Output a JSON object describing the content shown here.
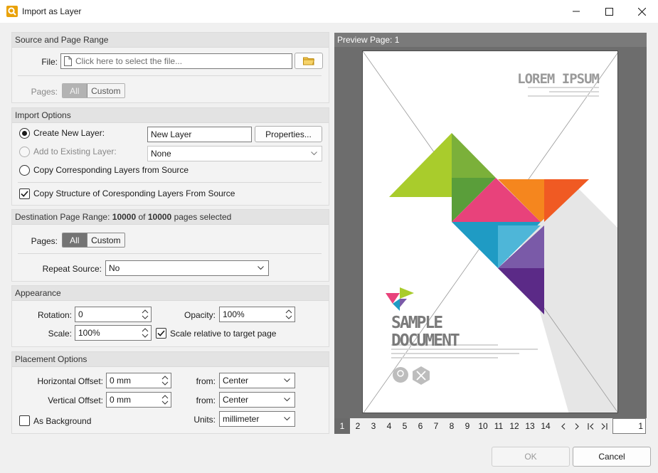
{
  "window": {
    "title": "Import as Layer"
  },
  "source": {
    "header": "Source and Page Range",
    "file_label": "File:",
    "file_placeholder": "Click here to select the file...",
    "pages_label": "Pages:",
    "pages_all": "All",
    "pages_custom": "Custom"
  },
  "import_options": {
    "header": "Import Options",
    "create_new_layer": "Create New Layer:",
    "new_layer_value": "New Layer",
    "properties": "Properties...",
    "add_existing": "Add to Existing Layer:",
    "existing_value": "None",
    "copy_layers": "Copy Corresponding Layers from Source",
    "copy_structure": "Copy Structure of Coresponding Layers From Source"
  },
  "destination": {
    "header_prefix": "Destination Page Range:",
    "selected": "10000",
    "of": "of",
    "total": "10000",
    "suffix": "pages selected",
    "pages_label": "Pages:",
    "pages_all": "All",
    "pages_custom": "Custom",
    "repeat_label": "Repeat Source:",
    "repeat_value": "No"
  },
  "appearance": {
    "header": "Appearance",
    "rotation_label": "Rotation:",
    "rotation_value": "0",
    "opacity_label": "Opacity:",
    "opacity_value": "100%",
    "scale_label": "Scale:",
    "scale_value": "100%",
    "scale_relative": "Scale relative to target page"
  },
  "placement": {
    "header": "Placement Options",
    "h_offset_label": "Horizontal Offset:",
    "h_offset_value": "0 mm",
    "v_offset_label": "Vertical Offset:",
    "v_offset_value": "0 mm",
    "from_label_1": "from:",
    "from_value_1": "Center",
    "from_label_2": "from:",
    "from_value_2": "Center",
    "units_label": "Units:",
    "units_value": "millimeter",
    "as_background": "As Background"
  },
  "preview": {
    "title": "Preview Page: 1",
    "doc": {
      "heading": "LOREM IPSUM",
      "sample_line1": "SAMPLE",
      "sample_line2": "DOCUMENT"
    },
    "pages": [
      "1",
      "2",
      "3",
      "4",
      "5",
      "6",
      "7",
      "8",
      "9",
      "10",
      "11",
      "12",
      "13",
      "14"
    ],
    "current_page": "1"
  },
  "footer": {
    "ok": "OK",
    "cancel": "Cancel"
  },
  "colors": {
    "accent": "#2b5fab",
    "segment_on": "#747474",
    "preview_bg": "#6d6d6d"
  }
}
